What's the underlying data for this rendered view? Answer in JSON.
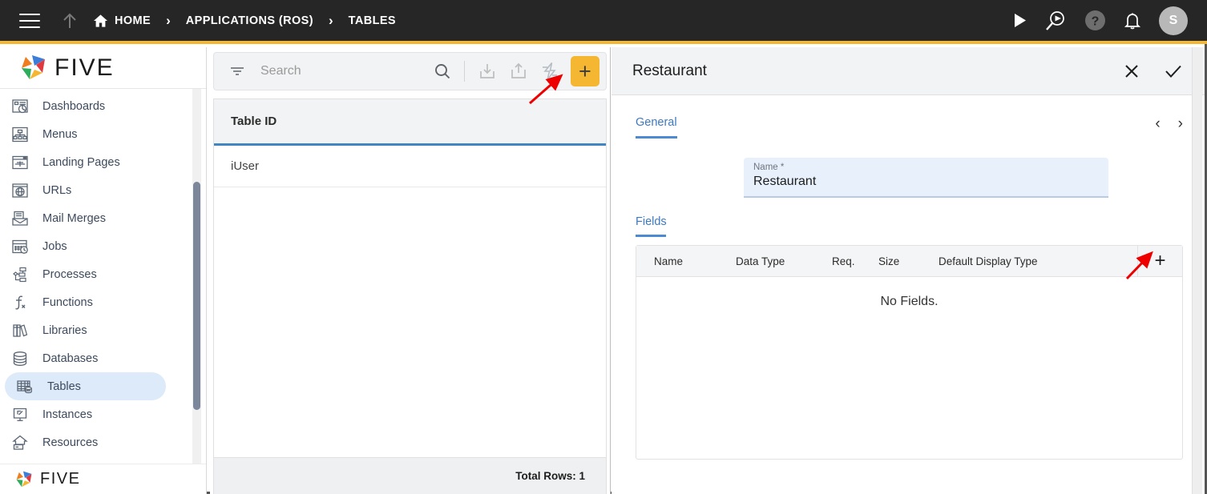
{
  "topbar": {
    "menu_icon": "hamburger-icon",
    "up_icon": "arrow-up-icon",
    "breadcrumbs": [
      {
        "label": "HOME",
        "icon": "home-icon"
      },
      {
        "label": "APPLICATIONS (ROS)",
        "icon": ""
      },
      {
        "label": "TABLES",
        "icon": ""
      }
    ],
    "separator": "›",
    "actions": [
      {
        "name": "run-icon",
        "glyph": "▶"
      },
      {
        "name": "debug-search-icon",
        "glyph": ""
      },
      {
        "name": "help-icon",
        "glyph": "?"
      },
      {
        "name": "notifications-bell-icon",
        "glyph": ""
      }
    ],
    "avatar_initial": "S",
    "accent_color": "#F5B731",
    "background_color": "#262626"
  },
  "sidebar": {
    "brand": "FIVE",
    "brand_footer": "FIVE",
    "items": [
      {
        "label": "Dashboards",
        "icon": "dashboard-icon",
        "active": false
      },
      {
        "label": "Menus",
        "icon": "menus-icon",
        "active": false
      },
      {
        "label": "Landing Pages",
        "icon": "landing-pages-icon",
        "active": false
      },
      {
        "label": "URLs",
        "icon": "urls-globe-icon",
        "active": false
      },
      {
        "label": "Mail Merges",
        "icon": "mail-merge-icon",
        "active": false
      },
      {
        "label": "Jobs",
        "icon": "jobs-calendar-icon",
        "active": false
      },
      {
        "label": "Processes",
        "icon": "processes-flow-icon",
        "active": false
      },
      {
        "label": "Functions",
        "icon": "functions-icon",
        "active": false
      },
      {
        "label": "Libraries",
        "icon": "libraries-books-icon",
        "active": false
      },
      {
        "label": "Databases",
        "icon": "databases-cylinder-icon",
        "active": false
      },
      {
        "label": "Tables",
        "icon": "tables-grid-icon",
        "active": true
      },
      {
        "label": "Instances",
        "icon": "instances-monitor-icon",
        "active": false
      },
      {
        "label": "Resources",
        "icon": "resources-icon",
        "active": false
      }
    ],
    "active_background": "#ddeafa"
  },
  "list_panel": {
    "search": {
      "value": "",
      "placeholder": "Search"
    },
    "toolbar": [
      {
        "name": "filter-icon",
        "label": "Filter"
      },
      {
        "name": "search-icon",
        "label": "Search"
      },
      {
        "name": "import-icon",
        "label": "Import"
      },
      {
        "name": "export-icon",
        "label": "Export"
      },
      {
        "name": "quick-actions-lightning-icon",
        "label": "Quick Actions"
      },
      {
        "name": "add-record-button",
        "label": "+"
      }
    ],
    "columns": [
      "Table ID"
    ],
    "rows": [
      [
        "iUser"
      ]
    ],
    "footer_text": "Total Rows: 1",
    "header_underline_color": "#4285c5"
  },
  "detail_panel": {
    "title": "Restaurant",
    "close_label": "✕",
    "save_label": "✓",
    "tabs": [
      {
        "label": "General",
        "active": true
      }
    ],
    "pager": {
      "prev": "‹",
      "next": "›"
    },
    "name_field": {
      "label": "Name *",
      "value": "Restaurant"
    },
    "fields_section": {
      "label": "Fields",
      "columns": [
        "Name",
        "Data Type",
        "Req.",
        "Size",
        "Default Display Type"
      ],
      "add_button_label": "+",
      "empty_text": "No Fields."
    },
    "accent_color": "#4d8ad4"
  },
  "annotations": [
    {
      "name": "arrow-to-quick-actions-icon",
      "color": "#ee0000"
    },
    {
      "name": "arrow-to-add-field-button",
      "color": "#ee0000"
    }
  ]
}
